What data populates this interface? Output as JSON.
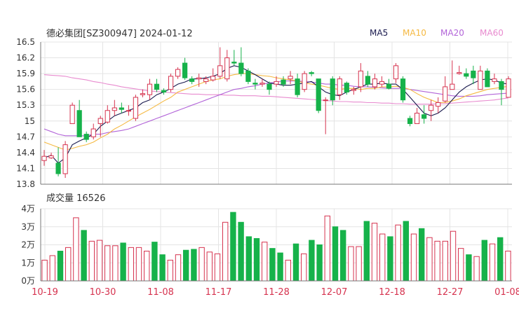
{
  "title": "德必集团[SZ300947] 2024-01-12",
  "volume_label": "成交量 16526",
  "legend": [
    {
      "name": "MA5",
      "color": "#1a1a4e"
    },
    {
      "name": "MA10",
      "color": "#f5b942"
    },
    {
      "name": "MA20",
      "color": "#b264d8"
    },
    {
      "name": "MA60",
      "color": "#e88bcf"
    }
  ],
  "colors": {
    "up": "#d6334f",
    "down": "#16b24a",
    "grid": "#e4e4e4",
    "axis": "#777777",
    "date": "#d6334f"
  },
  "chart_data": [
    {
      "type": "candlestick",
      "title": "德必集团[SZ300947] 2024-01-12",
      "ylim": [
        13.8,
        16.5
      ],
      "y_ticks": [
        "16.5",
        "16.2",
        "15.9",
        "15.6",
        "15.3",
        "15",
        "14.7",
        "14.4",
        "14.1",
        "13.8"
      ],
      "x_ticks": [
        "10-19",
        "10-30",
        "11-08",
        "11-17",
        "11-28",
        "12-07",
        "12-18",
        "12-27",
        "01-08"
      ],
      "ohlc": [
        [
          14.25,
          14.33,
          14.15,
          14.45
        ],
        [
          14.3,
          14.34,
          14.28,
          14.4
        ],
        [
          14.2,
          14.0,
          13.95,
          14.5
        ],
        [
          14.0,
          14.55,
          13.92,
          14.62
        ],
        [
          14.95,
          15.3,
          14.95,
          15.35
        ],
        [
          15.2,
          14.7,
          14.7,
          15.4
        ],
        [
          14.75,
          14.65,
          14.6,
          14.8
        ],
        [
          14.7,
          14.85,
          14.65,
          14.95
        ],
        [
          14.95,
          15.05,
          14.7,
          15.1
        ],
        [
          14.98,
          15.2,
          14.95,
          15.3
        ],
        [
          15.2,
          15.25,
          15.1,
          15.4
        ],
        [
          15.25,
          15.22,
          15.15,
          15.35
        ],
        [
          15.2,
          15.2,
          15.1,
          15.3
        ],
        [
          15.05,
          15.45,
          15.0,
          15.5
        ],
        [
          15.5,
          15.52,
          15.45,
          15.6
        ],
        [
          15.5,
          15.7,
          15.4,
          15.8
        ],
        [
          15.7,
          15.6,
          15.55,
          15.8
        ],
        [
          15.58,
          15.55,
          15.5,
          15.62
        ],
        [
          15.6,
          15.85,
          15.55,
          15.9
        ],
        [
          15.85,
          15.98,
          15.8,
          16.02
        ],
        [
          16.1,
          15.82,
          15.78,
          16.2
        ],
        [
          15.8,
          15.75,
          15.7,
          15.85
        ],
        [
          15.8,
          15.82,
          15.65,
          15.9
        ],
        [
          15.75,
          15.8,
          15.7,
          15.85
        ],
        [
          15.78,
          15.85,
          15.75,
          16.0
        ],
        [
          15.85,
          16.05,
          15.8,
          16.4
        ],
        [
          15.8,
          16.2,
          15.75,
          16.35
        ],
        [
          16.12,
          16.1,
          16.05,
          16.35
        ],
        [
          16.1,
          15.9,
          15.85,
          16.4
        ],
        [
          15.95,
          15.75,
          15.7,
          16.0
        ],
        [
          15.72,
          15.7,
          15.6,
          15.8
        ],
        [
          15.7,
          15.72,
          15.65,
          15.8
        ],
        [
          15.7,
          15.6,
          15.5,
          15.75
        ],
        [
          15.7,
          15.75,
          15.65,
          15.85
        ],
        [
          15.78,
          15.7,
          15.65,
          15.85
        ],
        [
          15.8,
          15.85,
          15.7,
          15.95
        ],
        [
          15.8,
          15.5,
          15.45,
          15.9
        ],
        [
          15.6,
          15.9,
          15.55,
          15.95
        ],
        [
          15.92,
          15.9,
          15.85,
          15.95
        ],
        [
          15.8,
          15.2,
          15.15,
          15.8
        ],
        [
          15.4,
          15.4,
          14.75,
          15.45
        ],
        [
          15.8,
          15.4,
          15.3,
          15.85
        ],
        [
          15.5,
          15.8,
          15.4,
          15.85
        ],
        [
          15.72,
          15.55,
          15.5,
          15.75
        ],
        [
          15.58,
          15.6,
          15.5,
          15.65
        ],
        [
          15.65,
          15.95,
          15.55,
          16.1
        ],
        [
          15.85,
          15.7,
          15.65,
          15.95
        ],
        [
          15.65,
          15.8,
          15.6,
          15.9
        ],
        [
          15.7,
          15.75,
          15.65,
          15.85
        ],
        [
          15.7,
          15.62,
          15.6,
          15.8
        ],
        [
          15.8,
          16.05,
          15.72,
          16.1
        ],
        [
          15.8,
          15.4,
          15.35,
          15.85
        ],
        [
          15.05,
          14.95,
          14.9,
          15.1
        ],
        [
          14.95,
          15.15,
          14.95,
          15.25
        ],
        [
          15.12,
          15.05,
          14.95,
          15.3
        ],
        [
          15.2,
          15.3,
          15.0,
          15.4
        ],
        [
          15.28,
          15.35,
          15.15,
          15.45
        ],
        [
          15.38,
          15.65,
          15.35,
          15.85
        ],
        [
          15.6,
          15.7,
          15.6,
          16.15
        ],
        [
          15.9,
          15.92,
          15.88,
          16.05
        ],
        [
          15.9,
          15.85,
          15.8,
          16.0
        ],
        [
          15.95,
          15.82,
          15.7,
          16.05
        ],
        [
          15.6,
          15.95,
          15.6,
          16.05
        ],
        [
          15.95,
          15.65,
          15.65,
          16.0
        ],
        [
          15.75,
          15.8,
          15.7,
          15.9
        ],
        [
          15.75,
          15.6,
          15.3,
          15.8
        ],
        [
          15.45,
          15.8,
          15.45,
          15.85
        ]
      ],
      "ma5": [
        14.3,
        14.35,
        14.2,
        14.3,
        14.55,
        14.62,
        14.68,
        14.75,
        14.9,
        15.0,
        15.1,
        15.15,
        15.2,
        15.25,
        15.35,
        15.4,
        15.5,
        15.55,
        15.62,
        15.7,
        15.74,
        15.8,
        15.8,
        15.82,
        15.85,
        15.9,
        16.0,
        16.05,
        16.02,
        15.95,
        15.88,
        15.8,
        15.72,
        15.7,
        15.68,
        15.68,
        15.7,
        15.72,
        15.75,
        15.65,
        15.55,
        15.5,
        15.48,
        15.55,
        15.6,
        15.65,
        15.7,
        15.7,
        15.72,
        15.7,
        15.7,
        15.6,
        15.45,
        15.3,
        15.15,
        15.1,
        15.15,
        15.25,
        15.4,
        15.55,
        15.65,
        15.72,
        15.78,
        15.8,
        15.78,
        15.72,
        15.7
      ],
      "ma10": [
        14.6,
        14.55,
        14.5,
        14.45,
        14.48,
        14.52,
        14.55,
        14.6,
        14.68,
        14.75,
        14.85,
        14.92,
        15.0,
        15.08,
        15.15,
        15.22,
        15.3,
        15.38,
        15.45,
        15.55,
        15.6,
        15.65,
        15.7,
        15.75,
        15.78,
        15.8,
        15.85,
        15.88,
        15.9,
        15.9,
        15.88,
        15.86,
        15.85,
        15.82,
        15.8,
        15.78,
        15.76,
        15.72,
        15.7,
        15.68,
        15.65,
        15.62,
        15.6,
        15.62,
        15.62,
        15.6,
        15.62,
        15.62,
        15.65,
        15.65,
        15.66,
        15.64,
        15.6,
        15.52,
        15.45,
        15.4,
        15.35,
        15.35,
        15.38,
        15.42,
        15.48,
        15.52,
        15.56,
        15.6,
        15.62,
        15.64,
        15.66
      ],
      "ma20": [
        14.85,
        14.8,
        14.75,
        14.72,
        14.72,
        14.72,
        14.72,
        14.75,
        14.75,
        14.78,
        14.8,
        14.82,
        14.85,
        14.9,
        14.95,
        15.0,
        15.05,
        15.1,
        15.15,
        15.2,
        15.25,
        15.3,
        15.35,
        15.4,
        15.45,
        15.5,
        15.55,
        15.6,
        15.62,
        15.65,
        15.67,
        15.7,
        15.72,
        15.74,
        15.76,
        15.76,
        15.76,
        15.75,
        15.74,
        15.72,
        15.7,
        15.7,
        15.68,
        15.68,
        15.66,
        15.65,
        15.65,
        15.64,
        15.63,
        15.62,
        15.62,
        15.62,
        15.6,
        15.58,
        15.56,
        15.54,
        15.52,
        15.5,
        15.48,
        15.47,
        15.47,
        15.47,
        15.48,
        15.5,
        15.51,
        15.52,
        15.53
      ],
      "ma60": [
        15.88,
        15.87,
        15.86,
        15.85,
        15.82,
        15.8,
        15.78,
        15.75,
        15.73,
        15.7,
        15.68,
        15.65,
        15.63,
        15.61,
        15.59,
        15.57,
        15.56,
        15.55,
        15.54,
        15.53,
        15.52,
        15.51,
        15.51,
        15.5,
        15.5,
        15.5,
        15.49,
        15.49,
        15.48,
        15.48,
        15.48,
        15.47,
        15.47,
        15.46,
        15.45,
        15.44,
        15.43,
        15.42,
        15.41,
        15.4,
        15.39,
        15.38,
        15.37,
        15.37,
        15.36,
        15.36,
        15.35,
        15.35,
        15.34,
        15.34,
        15.33,
        15.33,
        15.32,
        15.32,
        15.32,
        15.32,
        15.33,
        15.33,
        15.34,
        15.35,
        15.36,
        15.37,
        15.38,
        15.39,
        15.4,
        15.42,
        15.44
      ]
    },
    {
      "type": "bar",
      "title": "成交量 16526",
      "ylim": [
        0,
        40000
      ],
      "y_ticks": [
        "4万",
        "3万",
        "2万",
        "1万",
        "0万"
      ],
      "volume": [
        11500,
        14000,
        16500,
        18500,
        35000,
        28000,
        22000,
        22500,
        19500,
        19500,
        21000,
        18500,
        18500,
        16500,
        21500,
        14500,
        11500,
        14500,
        17000,
        17500,
        18500,
        16000,
        15000,
        32500,
        38000,
        32500,
        24500,
        23500,
        21500,
        18000,
        15500,
        11500,
        20500,
        15000,
        22500,
        20000,
        36000,
        30000,
        28000,
        19000,
        19000,
        33000,
        32000,
        26000,
        24500,
        31000,
        33000,
        26000,
        29000,
        24000,
        22000,
        22000,
        27500,
        18000,
        14500,
        13500,
        22500,
        20500,
        24000,
        16526
      ]
    }
  ]
}
